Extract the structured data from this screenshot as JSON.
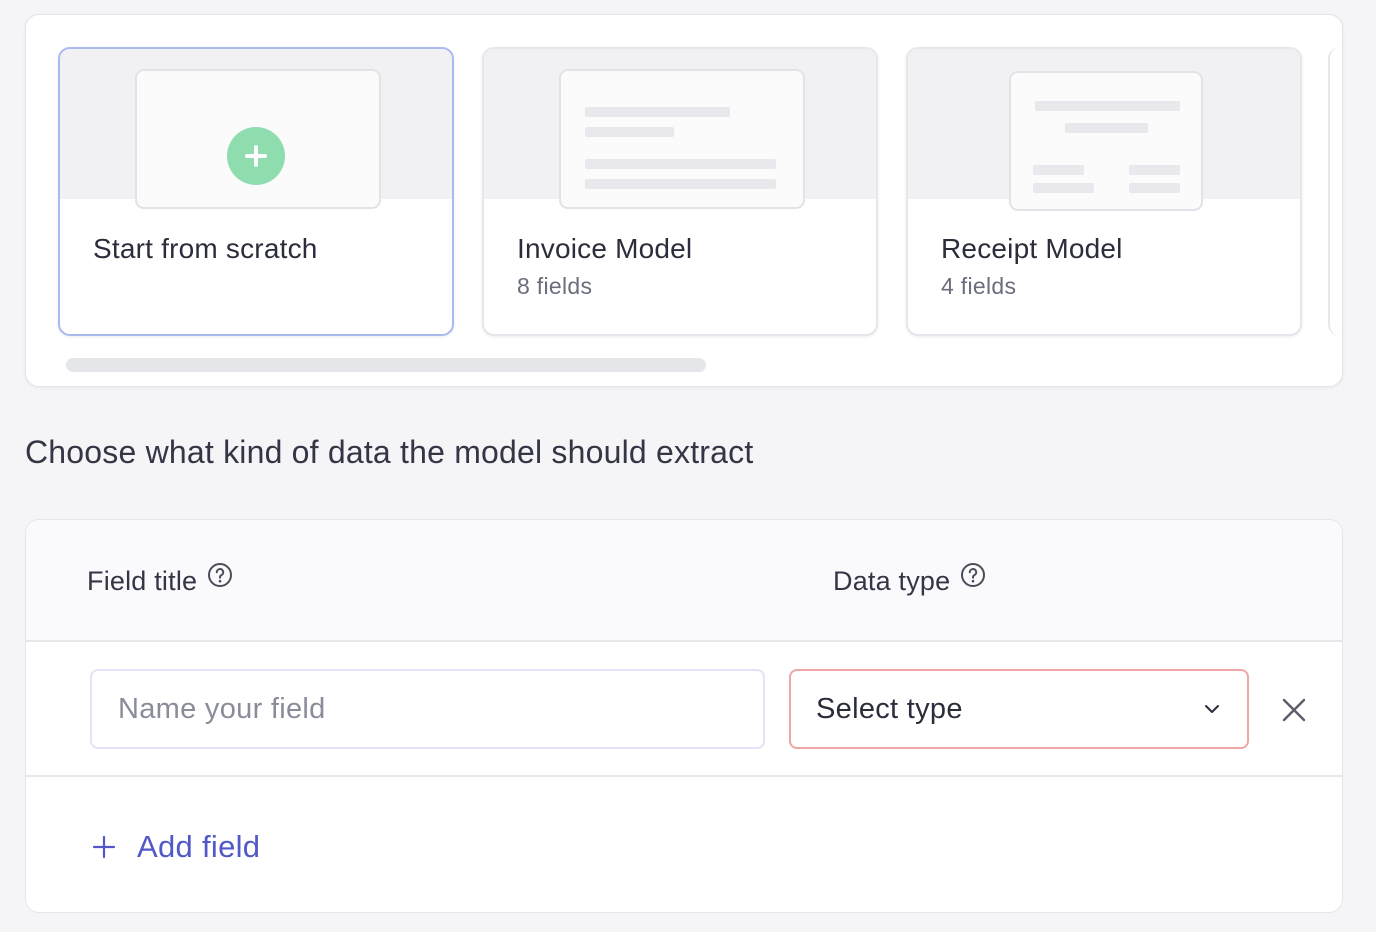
{
  "templates": {
    "cards": [
      {
        "title": "Start from scratch",
        "subtitle": "",
        "selected": true
      },
      {
        "title": "Invoice Model",
        "subtitle": "8 fields",
        "selected": false
      },
      {
        "title": "Receipt Model",
        "subtitle": "4 fields",
        "selected": false
      }
    ]
  },
  "section": {
    "heading": "Choose what kind of data the model should extract"
  },
  "fields_table": {
    "columns": [
      {
        "label": "Field title",
        "icon": "help-circle-icon"
      },
      {
        "label": "Data type",
        "icon": "help-circle-icon"
      }
    ],
    "rows": [
      {
        "name_value": "",
        "name_placeholder": "Name your field",
        "type_value": "Select type"
      }
    ],
    "add_label": "Add field"
  },
  "colors": {
    "accent": "#5257c9",
    "selected_border": "#a9baf0",
    "plus_circle": "#8fdcae",
    "error_border": "#eea7a4"
  }
}
